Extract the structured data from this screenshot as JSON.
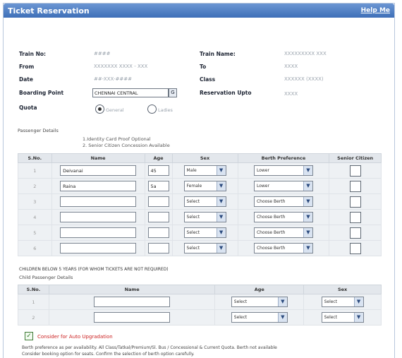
{
  "window": {
    "title": "Ticket Reservation",
    "help_label": "Help Me"
  },
  "info": {
    "train_no_label": "Train No:",
    "train_no_value": "####",
    "train_name_label": "Train Name:",
    "train_name_value": "XXXXXXXXX XXX",
    "from_label": "From",
    "from_value": "XXXXXXX XXXX - XXX",
    "to_label": "To",
    "to_value": "XXXX",
    "date_label": "Date",
    "date_value": "##-XXX-####",
    "class_label": "Class",
    "class_value": "XXXXXX (XXXX)",
    "boarding_label": "Boarding Point",
    "boarding_value": "CHENNAI CENTRAL",
    "boarding_btn": "G",
    "reservation_upto_label": "Reservation Upto",
    "reservation_upto_value": "XXXX",
    "quota_label": "Quota",
    "quota_general": "General",
    "quota_ladies": "Ladies"
  },
  "passenger_section": {
    "label": "Passenger Details",
    "note1": "1.Identity Card Proof Optional",
    "note2": "2. Senior Citizen Concession Available",
    "headers": [
      "S.No.",
      "Name",
      "Age",
      "Sex",
      "Berth Preference",
      "Senior Citizen"
    ],
    "rows": [
      {
        "no": "1",
        "name": "Deivanai",
        "age": "45",
        "sex": "Male",
        "berth": "Lower"
      },
      {
        "no": "2",
        "name": "Raina",
        "age": "5a",
        "sex": "Female",
        "berth": "Lower"
      },
      {
        "no": "3",
        "name": "",
        "age": "",
        "sex": "Select",
        "berth": "Choose Berth"
      },
      {
        "no": "4",
        "name": "",
        "age": "",
        "sex": "Select",
        "berth": "Choose Berth"
      },
      {
        "no": "5",
        "name": "",
        "age": "",
        "sex": "Select",
        "berth": "Choose Berth"
      },
      {
        "no": "6",
        "name": "",
        "age": "",
        "sex": "Select",
        "berth": "Choose Berth"
      }
    ]
  },
  "child_section": {
    "warning": "CHILDREN BELOW 5 YEARS (FOR WHOM TICKETS ARE NOT REQUIRED)",
    "label": "Child Passenger Details",
    "headers": [
      "S.No.",
      "Name",
      "Age",
      "Sex"
    ],
    "rows": [
      {
        "no": "1",
        "name": "",
        "age": "Select",
        "sex": "Select"
      },
      {
        "no": "2",
        "name": "",
        "age": "Select",
        "sex": "Select"
      }
    ]
  },
  "insurance": {
    "checkbox_mark": "✓",
    "label": "Consider for Auto Upgradation",
    "text1": "Berth preference as per availability. All Class/Tatkal/Premium/Sl. Bus / Concessional & Current Quota. Berth not available",
    "text2": "Consider booking option for seats. Confirm the selection of berth option carefully."
  }
}
